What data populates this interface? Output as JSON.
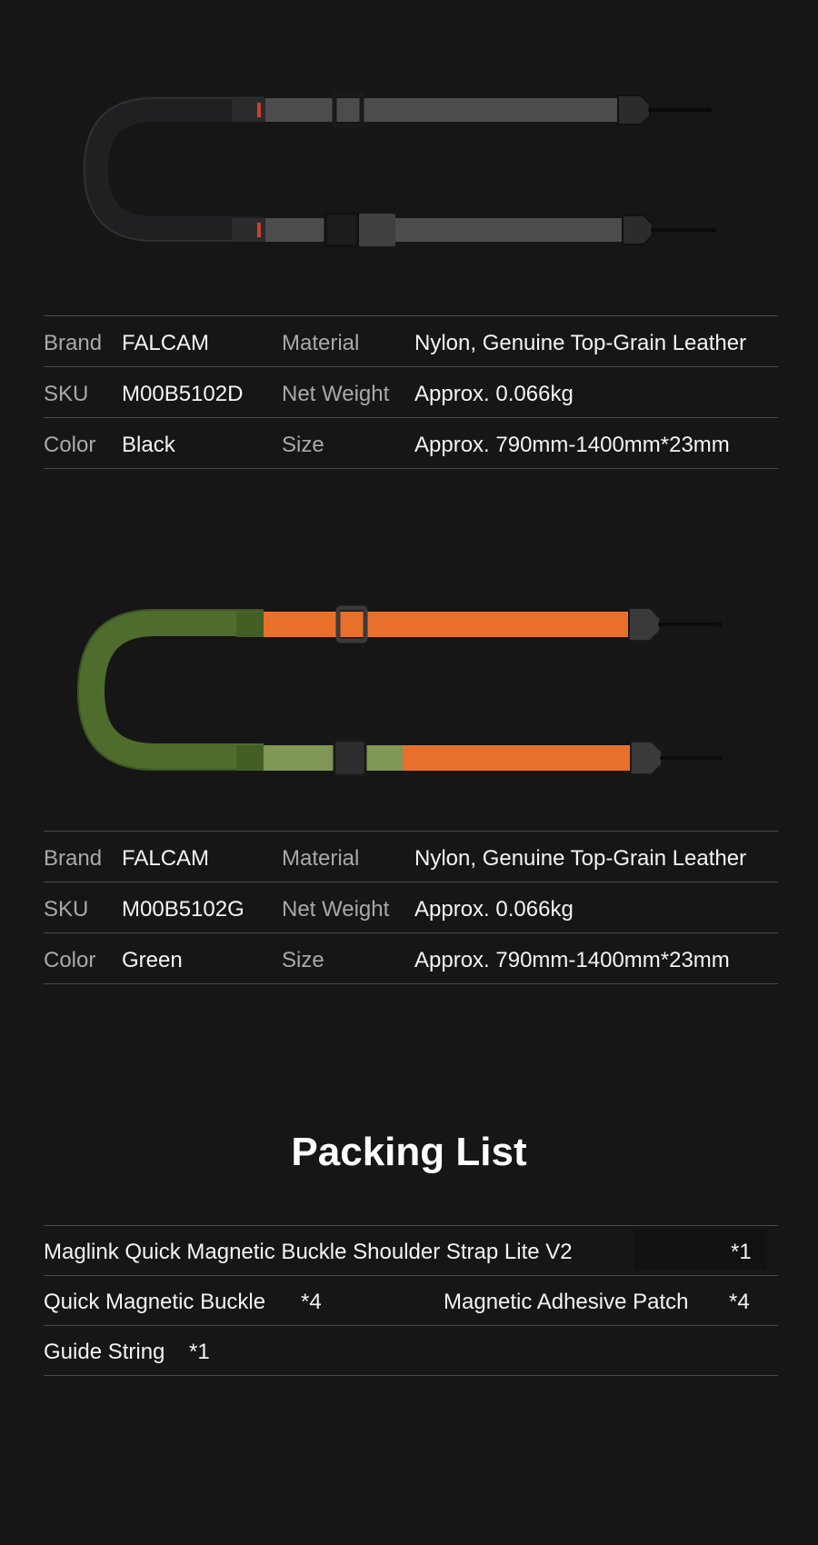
{
  "products": [
    {
      "variant": "black",
      "specs": [
        {
          "label1": "Brand",
          "value1": "FALCAM",
          "label2": "Material",
          "value2": "Nylon, Genuine Top-Grain Leather"
        },
        {
          "label1": "SKU",
          "value1": "M00B5102D",
          "label2": "Net Weight",
          "value2": "Approx. 0.066kg"
        },
        {
          "label1": "Color",
          "value1": "Black",
          "label2": "Size",
          "value2": "Approx. 790mm-1400mm*23mm"
        }
      ],
      "colors": {
        "strap": "#4a4b4a",
        "leather": "#232425",
        "accent": "#c8412c"
      }
    },
    {
      "variant": "green",
      "specs": [
        {
          "label1": "Brand",
          "value1": "FALCAM",
          "label2": "Material",
          "value2": "Nylon, Genuine Top-Grain Leather"
        },
        {
          "label1": "SKU",
          "value1": "M00B5102G",
          "label2": "Net Weight",
          "value2": "Approx. 0.066kg"
        },
        {
          "label1": "Color",
          "value1": "Green",
          "label2": "Size",
          "value2": "Approx. 790mm-1400mm*23mm"
        }
      ],
      "colors": {
        "strap": "#e8702a",
        "leather": "#4e6c2c",
        "accent": "#7f9654"
      }
    }
  ],
  "packing": {
    "title": "Packing List",
    "rows": [
      {
        "item1": "Maglink Quick Magnetic Buckle Shoulder Strap Lite V2",
        "qty1": "*1"
      },
      {
        "item1": "Quick Magnetic Buckle",
        "qty1": "*4",
        "item2": "Magnetic Adhesive Patch",
        "qty2": "*4"
      },
      {
        "item1": "Guide String",
        "qty1": "*1"
      }
    ]
  }
}
